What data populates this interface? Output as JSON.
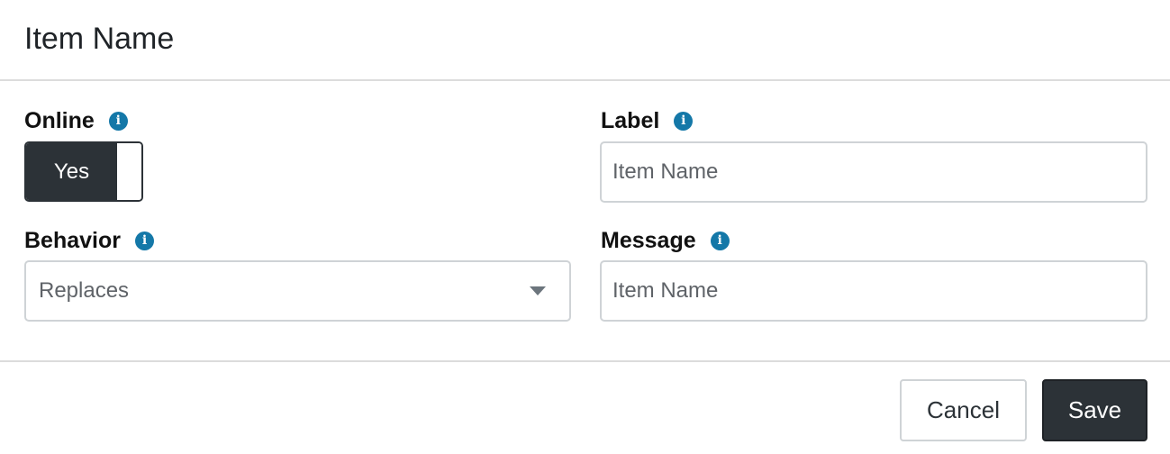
{
  "dialog": {
    "title": "Item Name"
  },
  "fields": {
    "online": {
      "label": "Online",
      "toggle_text": "Yes",
      "info_icon": "info-icon"
    },
    "label": {
      "label": "Label",
      "placeholder": "Item Name",
      "info_icon": "info-icon"
    },
    "behavior": {
      "label": "Behavior",
      "selected": "Replaces",
      "info_icon": "info-icon"
    },
    "message": {
      "label": "Message",
      "placeholder": "Item Name",
      "info_icon": "info-icon"
    }
  },
  "footer": {
    "cancel_label": "Cancel",
    "save_label": "Save"
  },
  "colors": {
    "primary_dark": "#2c3237",
    "info_blue": "#1478a8",
    "border": "#cfd3d6"
  }
}
